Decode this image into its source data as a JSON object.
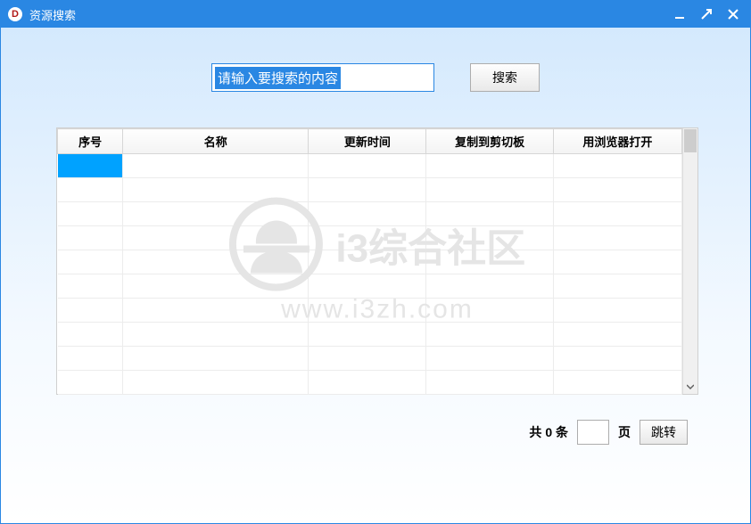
{
  "titlebar": {
    "app_icon_letter": "D",
    "title": "资源搜索"
  },
  "search": {
    "placeholder": "请输入要搜索的内容",
    "value": "",
    "button_label": "搜索"
  },
  "table": {
    "columns": [
      "序号",
      "名称",
      "更新时间",
      "复制到剪切板",
      "用浏览器打开"
    ],
    "rows": []
  },
  "watermark": {
    "line1": "i3综合社区",
    "line2": "www.i3zh.com"
  },
  "footer": {
    "total_prefix": "共",
    "total_count": 0,
    "total_suffix": "条",
    "page_value": "",
    "page_label": "页",
    "jump_label": "跳转"
  }
}
